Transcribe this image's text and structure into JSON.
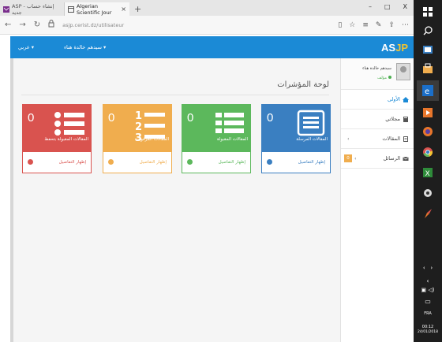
{
  "browser": {
    "tabs": [
      {
        "title": "ASP - إنشاء حساب جديد"
      },
      {
        "title": "Algerian Scientific Jour"
      }
    ],
    "new_tab": "+",
    "url": "asjp.cerist.dz/utilisateur",
    "window_controls": [
      "–",
      "□",
      "X"
    ]
  },
  "header": {
    "language": "عربي ▾",
    "user_menu": "سيدهم خالدة هناء ▾",
    "brand_prefix": "AS",
    "brand_suffix": "JP",
    "brand_color": "#1b8ad6",
    "brand_accent": "#f4c430"
  },
  "sidebar": {
    "profile_name": "سيدهم خالدة هناء",
    "profile_status": "مؤلف",
    "items": [
      {
        "label": "الأولى",
        "icon": "home-icon"
      },
      {
        "label": "مجلاتي",
        "icon": "book-icon"
      },
      {
        "label": "المقالات",
        "icon": "file-icon"
      },
      {
        "label": "الرسائل",
        "icon": "envelope-icon",
        "badge": "0"
      }
    ]
  },
  "main": {
    "title": "لوحة المؤشرات",
    "cards": [
      {
        "count": "0",
        "label": "المقالات المرسلة",
        "details": "إظهار التفاصيل",
        "color": "#3a7fc1",
        "icon": "list-icon"
      },
      {
        "count": "0",
        "label": "المقالات المقبولة",
        "details": "إظهار التفاصيل",
        "color": "#5cb85c",
        "icon": "list-icon"
      },
      {
        "count": "0",
        "label": "المقالات المرفوضة",
        "details": "إظهار التفاصيل",
        "color": "#f0ad4e",
        "icon": "numbered-list-icon"
      },
      {
        "count": "0",
        "label": "المقالات المقبولة بتحفظ",
        "details": "إظهار التفاصيل",
        "color": "#d9534f",
        "icon": "list-icon"
      }
    ]
  },
  "taskbar": {
    "language": "FRA",
    "time": "00:12",
    "date": "24/01/2018"
  }
}
